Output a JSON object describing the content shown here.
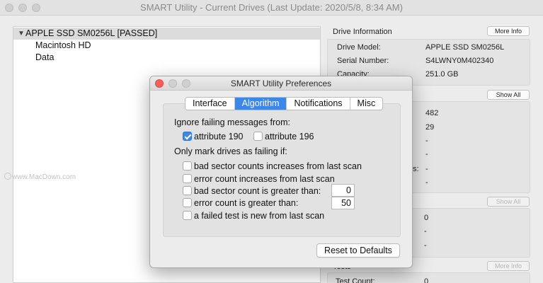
{
  "main_window": {
    "title": "SMART Utility - Current Drives (Last Update: 2020/5/8, 8:34 AM)"
  },
  "tree": {
    "drive": "APPLE SSD SM0256L  [PASSED]",
    "volumes": [
      "Macintosh HD",
      "Data"
    ]
  },
  "drive_information": {
    "heading": "Drive Information",
    "more_info_label": "More Info",
    "rows": [
      {
        "label": "Drive Model:",
        "value": "APPLE SSD SM0256L"
      },
      {
        "label": "Serial Number:",
        "value": "S4LWNY0M402340"
      },
      {
        "label": "Capacity:",
        "value": "251.0 GB"
      }
    ]
  },
  "attributes_section": {
    "show_all_label": "Show All",
    "values": [
      "482",
      "29",
      "-",
      "-",
      "-",
      "-"
    ],
    "partial_label": "s:"
  },
  "errors_section": {
    "show_all_label": "Show All",
    "values": [
      "0",
      "-",
      "-"
    ]
  },
  "tests_section": {
    "heading": "Tests",
    "more_info_label": "More Info",
    "row_label": "Test Count:",
    "row_value": "0"
  },
  "watermark": "www.MacDown.com",
  "dialog": {
    "title": "SMART Utility Preferences",
    "tabs": [
      "Interface",
      "Algorithm",
      "Notifications",
      "Misc"
    ],
    "active_tab": "Algorithm",
    "ignore_heading": "Ignore failing messages from:",
    "ignore_options": [
      {
        "label": "attribute 190",
        "checked": true
      },
      {
        "label": "attribute 196",
        "checked": false
      }
    ],
    "mark_heading": "Only mark drives as failing if:",
    "mark_options": [
      {
        "label": "bad sector counts increases from last scan",
        "checked": false
      },
      {
        "label": "error count increases from last scan",
        "checked": false
      },
      {
        "label": "bad sector count is greater than:",
        "checked": false,
        "field_value": "0"
      },
      {
        "label": "error count is greater than:",
        "checked": false,
        "field_value": "50"
      },
      {
        "label": "a failed test is new from last scan",
        "checked": false
      }
    ],
    "reset_label": "Reset to Defaults"
  }
}
